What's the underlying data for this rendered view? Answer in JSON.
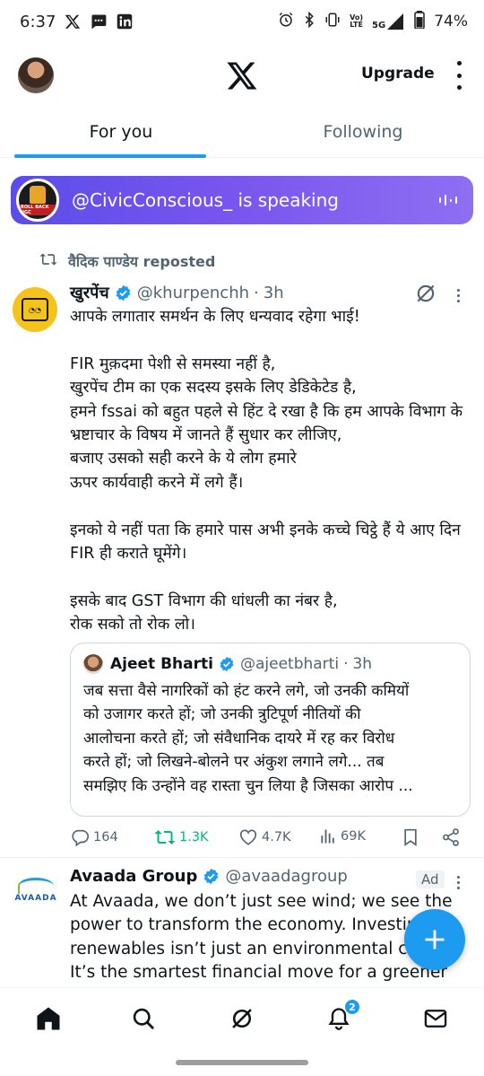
{
  "status_bar": {
    "time": "6:37",
    "battery": "74%",
    "network_labels": [
      "Vo)",
      "LTE",
      "5G"
    ],
    "left_icons": [
      "x-app-icon",
      "messages-icon",
      "linkedin-icon"
    ],
    "right_icons": [
      "alarm-icon",
      "bluetooth-icon",
      "vibrate-icon",
      "signal-icon",
      "battery-icon"
    ]
  },
  "header": {
    "upgrade_label": "Upgrade"
  },
  "tabs": [
    {
      "label": "For you",
      "active": true
    },
    {
      "label": "Following",
      "active": false
    }
  ],
  "space": {
    "avatar_label": "ROLL BACK UGC",
    "host": "@CivicConscious_",
    "status": "is speaking"
  },
  "tweet": {
    "reposted_by": "वैदिक पाण्डेय reposted",
    "author_name": "खुरपेंच",
    "author_handle": "@khurpenchh",
    "time": "3h",
    "body": [
      "आपके लगातार समर्थन के लिए धन्यवाद रहेगा भाई!",
      "FIR मुक़दमा पेशी से समस्या नहीं है,\nखुरपेंच टीम का एक सदस्य इसके लिए डेडिकेटेड है,\nहमने fssai को बहुत पहले से हिंट दे रखा है कि हम आपके विभाग के भ्रष्टाचार के विषय में जानते हैं सुधार कर लीजिए,\nबजाए उसको सही करने के ये लोग हमारे\nऊपर कार्यवाही करने में लगे हैं।",
      "इनको ये नहीं पता कि हमारे पास अभी इनके कच्चे चिट्ठे हैं ये आए दिन FIR ही कराते घूमेंगे।",
      "इसके बाद  GST विभाग की धांधली का नंबर है,\nरोक सको तो रोक लो।"
    ],
    "quote": {
      "author_name": "Ajeet Bharti",
      "author_handle": "@ajeetbharti",
      "time": "3h",
      "lines": [
        "जब सत्ता वैसे नागरिकों को हंट करने लगे, जो उनकी कमियों",
        "को उजागर करते हों; जो उनकी त्रुटिपूर्ण नीतियों की",
        "आलोचना करते हों; जो संवैधानिक दायरे में रह कर विरोध",
        "करते हों; जो लिखने-बोलने पर अंकुश लगाने लगे... तब",
        "समझिए कि उन्होंने वह रास्ता चुन लिया है जिसका आरोप ..."
      ]
    },
    "stats": {
      "replies": "164",
      "reposts": "1.3K",
      "likes": "4.7K",
      "views": "69K"
    }
  },
  "ad": {
    "logo_text": "AVAADA",
    "author_name": "Avaada Group",
    "author_handle": "@avaadagroup",
    "badge": "Ad",
    "lines": [
      "At Avaada, we don’t just see wind; we see the",
      "power to transform the economy. Investing in",
      "renewables isn’t just an environmental ch",
      "It’s the smartest financial move for a greener"
    ]
  },
  "nav": {
    "notifications_count": "2"
  },
  "colors": {
    "accent": "#1d9bf0",
    "repost_green": "#00ba7c",
    "space_gradient_start": "#5b4de8",
    "space_gradient_end": "#8e6ff2",
    "secondary_text": "#536471"
  }
}
